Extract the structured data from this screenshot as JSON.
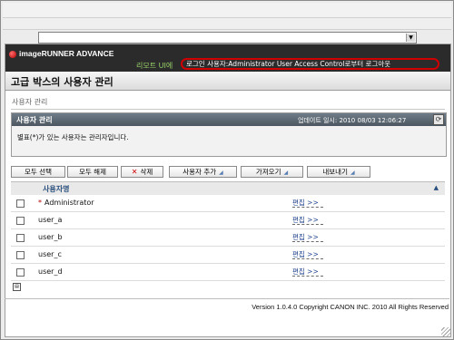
{
  "browser": {
    "address_value": ""
  },
  "header": {
    "brand": "imageRUNNER ADVANCE",
    "remote_ui": "리모트 UI에",
    "login_status": "로그인 사용자:Administrator User Access Control로부터 로그아웃",
    "page_title": "고급 박스의 사용자 관리"
  },
  "breadcrumb": "사용자 관리",
  "panel": {
    "title": "사용자 관리",
    "updated": "업데이트 일시: 2010 08/03 12:06:27",
    "note": "별표(*)가 있는 사용자는 관리자입니다."
  },
  "toolbar": {
    "select_all": "모두 선택",
    "deselect_all": "모두 해제",
    "delete": "삭제",
    "add_user": "사용자 추가",
    "import": "가져오기",
    "export": "내보내기"
  },
  "table": {
    "column_header": "사용자명",
    "edit_label": "편집 >>",
    "rows": [
      {
        "name": "Administrator",
        "admin": true,
        "star": "*"
      },
      {
        "name": "user_a",
        "admin": false
      },
      {
        "name": "user_b",
        "admin": false
      },
      {
        "name": "user_c",
        "admin": false
      },
      {
        "name": "user_d",
        "admin": false
      }
    ]
  },
  "footer": "Version 1.0.4.0 Copyright CANON INC. 2010 All Rights Reserved",
  "colors": {
    "header_bg": "#2b2b2b",
    "highlight_border": "#d00000",
    "panel_head": "#56626c",
    "link": "#1f3f8a"
  }
}
